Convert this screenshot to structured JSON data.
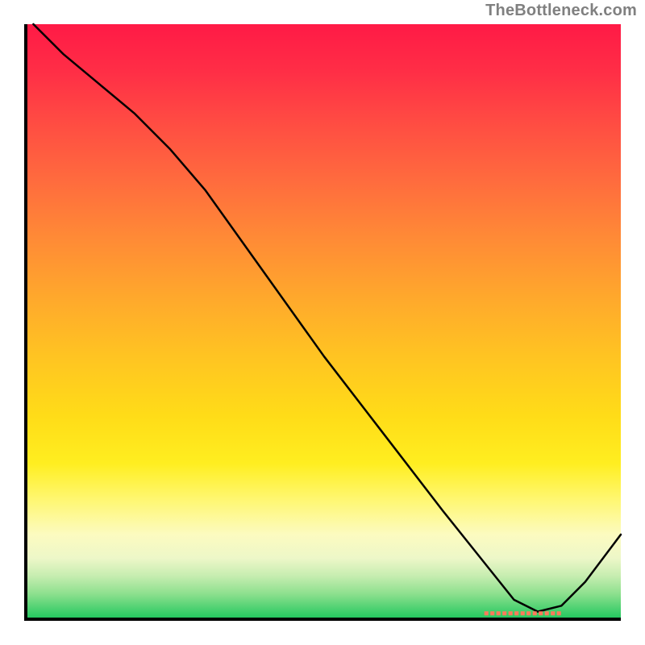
{
  "watermark": "TheBottleneck.com",
  "chart_data": {
    "type": "line",
    "title": "",
    "xlabel": "",
    "ylabel": "",
    "xlim": [
      0,
      100
    ],
    "ylim": [
      0,
      100
    ],
    "grid": false,
    "legend": false,
    "x": [
      1,
      6,
      12,
      18,
      24,
      30,
      40,
      50,
      60,
      70,
      78,
      82,
      86,
      90,
      94,
      100
    ],
    "values": [
      100,
      95,
      90,
      85,
      79,
      72,
      58,
      44,
      31,
      18,
      8,
      3,
      1,
      2,
      6,
      14
    ],
    "marker": {
      "x_start": 77,
      "x_end": 90,
      "y": 0.7
    },
    "colors": {
      "gradient_top": "#ff1a46",
      "gradient_mid": "#ffe018",
      "gradient_bottom": "#25c860",
      "line": "#000000",
      "marker": "#ff7a5a",
      "axes": "#000000"
    }
  }
}
